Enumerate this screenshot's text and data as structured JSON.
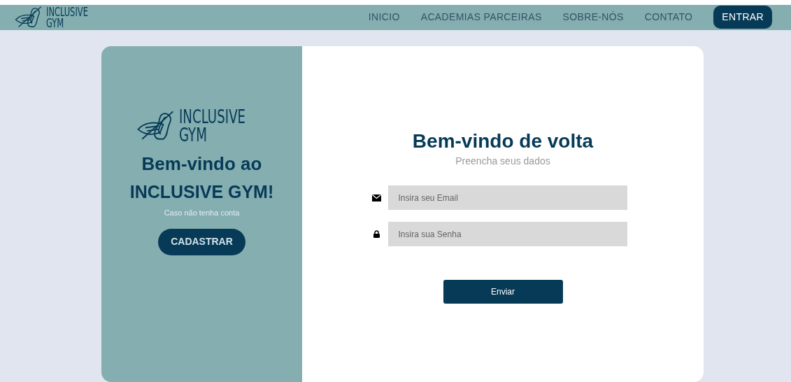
{
  "header": {
    "logo": {
      "line_1": "INCLUSIVE",
      "line_2": "GYM"
    },
    "nav": [
      {
        "label": "INICIO",
        "kind": "link"
      },
      {
        "label": "ACADEMIAS PARCEIRAS",
        "kind": "link"
      },
      {
        "label": "SOBRE-NÓS",
        "kind": "link"
      },
      {
        "label": "CONTATO",
        "kind": "link"
      },
      {
        "label": "ENTRAR",
        "kind": "button"
      }
    ]
  },
  "welcome_panel": {
    "logo": {
      "line_1": "INCLUSIVE",
      "line_2": "GYM"
    },
    "title_line_1": "Bem-vindo ao",
    "title_line_2": "INCLUSIVE GYM!",
    "subtitle": "Caso não tenha conta",
    "button": "CADASTRAR"
  },
  "login": {
    "title": "Bem-vindo de volta",
    "subtitle": "Preencha seus dados",
    "fields": [
      {
        "kind": "email",
        "placeholder": "Insira seu Email"
      },
      {
        "kind": "password",
        "placeholder": "Insira sua Senha"
      }
    ],
    "submit": "Enviar"
  }
}
